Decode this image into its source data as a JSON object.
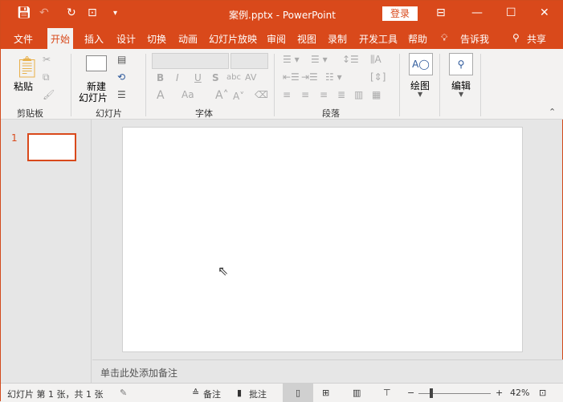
{
  "titlebar": {
    "title": "案例.pptx  -  PowerPoint",
    "login": "登录",
    "icons": [
      "save-icon",
      "undo-icon",
      "redo-icon",
      "start-slideshow-icon",
      "customize-icon",
      "ribbon-display-icon",
      "minimize-icon",
      "maximize-icon",
      "close-icon"
    ]
  },
  "tabs": [
    "文件",
    "开始",
    "插入",
    "设计",
    "切换",
    "动画",
    "幻灯片放映",
    "审阅",
    "视图",
    "录制",
    "开发工具",
    "帮助"
  ],
  "tell_me": "告诉我",
  "share": "共享",
  "ribbon": {
    "clipboard": {
      "label": "剪贴板",
      "paste": "粘贴"
    },
    "slides": {
      "label": "幻灯片",
      "new_slide_line1": "新建",
      "new_slide_line2": "幻灯片"
    },
    "font": {
      "label": "字体",
      "bold": "B",
      "italic": "I",
      "underline": "U",
      "shadow": "S",
      "strike": "abc",
      "spacing": "AV",
      "case": "Aa"
    },
    "paragraph": {
      "label": "段落"
    },
    "drawing": {
      "label": "绘图"
    },
    "editing": {
      "label": "编辑"
    }
  },
  "thumbs": {
    "number": "1"
  },
  "notes": {
    "placeholder": "单击此处添加备注"
  },
  "status": {
    "slide_info": "幻灯片 第 1 张，共 1 张",
    "notes": "备注",
    "comments": "批注",
    "zoom": "42%",
    "zoom_value": 42
  },
  "colors": {
    "accent": "#d9491b",
    "ribbon": "#f3f2f1",
    "workspace": "#e6e6e6"
  }
}
